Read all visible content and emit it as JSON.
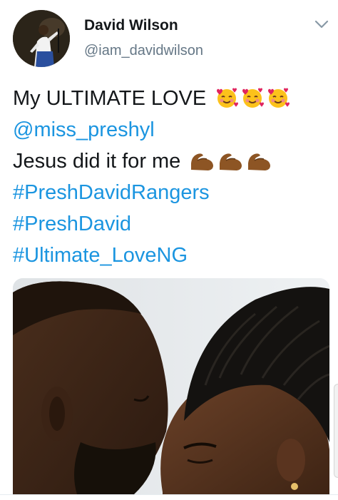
{
  "tweet": {
    "author": {
      "display_name": "David Wilson",
      "handle": "@iam_davidwilson"
    },
    "text_lines": [
      {
        "text": "My ULTIMATE LOVE",
        "kind": "text",
        "emoji": "smiling-face-with-hearts",
        "emoji_count": 3
      },
      {
        "text": "@miss_preshyl",
        "kind": "mention"
      },
      {
        "text": "Jesus did it for me",
        "kind": "text",
        "emoji": "flexed-biceps",
        "emoji_count": 3
      },
      {
        "text": "#PreshDavidRangers",
        "kind": "hashtag"
      },
      {
        "text": "#PreshDavid",
        "kind": "hashtag"
      },
      {
        "text": "#Ultimate_LoveNG",
        "kind": "hashtag"
      }
    ],
    "media": {
      "type": "photo"
    },
    "icons": {
      "menu": "chevron-down-icon"
    }
  },
  "colors": {
    "link": "#1b95e0",
    "text": "#14171a",
    "secondary": "#657786"
  }
}
